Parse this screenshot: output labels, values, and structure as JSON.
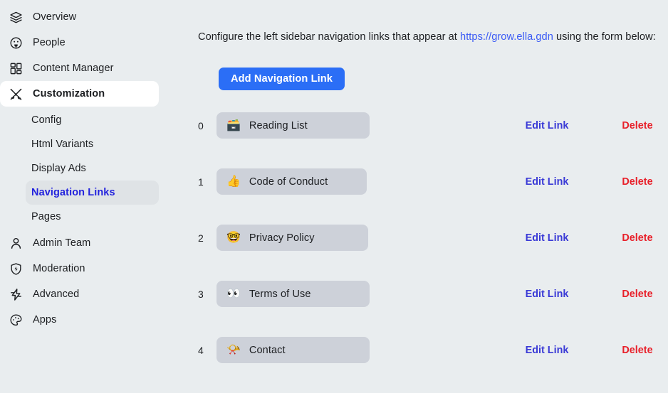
{
  "sidebar": {
    "items": [
      {
        "label": "Overview",
        "icon": "layers-icon",
        "type": "top",
        "state": "normal"
      },
      {
        "label": "People",
        "icon": "people-icon",
        "type": "top",
        "state": "normal"
      },
      {
        "label": "Content Manager",
        "icon": "grid-icon",
        "type": "top",
        "state": "normal"
      },
      {
        "label": "Customization",
        "icon": "tools-icon",
        "type": "top",
        "state": "active"
      },
      {
        "label": "Config",
        "icon": "",
        "type": "sub",
        "state": "normal"
      },
      {
        "label": "Html Variants",
        "icon": "",
        "type": "sub",
        "state": "normal"
      },
      {
        "label": "Display Ads",
        "icon": "",
        "type": "sub",
        "state": "normal"
      },
      {
        "label": "Navigation Links",
        "icon": "",
        "type": "sub",
        "state": "selected"
      },
      {
        "label": "Pages",
        "icon": "",
        "type": "sub",
        "state": "normal"
      },
      {
        "label": "Admin Team",
        "icon": "person-icon",
        "type": "top",
        "state": "normal"
      },
      {
        "label": "Moderation",
        "icon": "shield-bolt-icon",
        "type": "top",
        "state": "normal"
      },
      {
        "label": "Advanced",
        "icon": "bolt-icon",
        "type": "top",
        "state": "normal"
      },
      {
        "label": "Apps",
        "icon": "palette-icon",
        "type": "top",
        "state": "normal"
      }
    ]
  },
  "main": {
    "intro_prefix": "Configure the left sidebar navigation links that appear at ",
    "intro_link": "https://grow.ella.gdn",
    "intro_suffix": " using the form below:",
    "add_button_label": "Add Navigation Link",
    "edit_label": "Edit Link",
    "delete_label": "Delete",
    "rows": [
      {
        "index": "0",
        "emoji": "🗃️",
        "emoji_name": "card-file-box-emoji",
        "label": "Reading List",
        "pill_width": 215
      },
      {
        "index": "1",
        "emoji": "👍",
        "emoji_name": "thumbs-up-emoji",
        "label": "Code of Conduct",
        "pill_width": 211
      },
      {
        "index": "2",
        "emoji": "🤓",
        "emoji_name": "nerd-face-emoji",
        "label": "Privacy Policy",
        "pill_width": 213
      },
      {
        "index": "3",
        "emoji": "👀",
        "emoji_name": "eyes-emoji",
        "label": "Terms of Use",
        "pill_width": 215
      },
      {
        "index": "4",
        "emoji": "📯",
        "emoji_name": "postal-horn-emoji",
        "label": "Contact",
        "pill_width": 215
      }
    ]
  },
  "colors": {
    "page_bg": "#e9edef",
    "pill_bg": "#cdd1d9",
    "accent_blue": "#2b6ef6",
    "link_blue": "#3b5bf5",
    "edit_blue": "#3a3ad6",
    "delete_red": "#e8202a",
    "selected_sub_bg": "#dfe3e6",
    "active_item_bg": "#ffffff"
  }
}
